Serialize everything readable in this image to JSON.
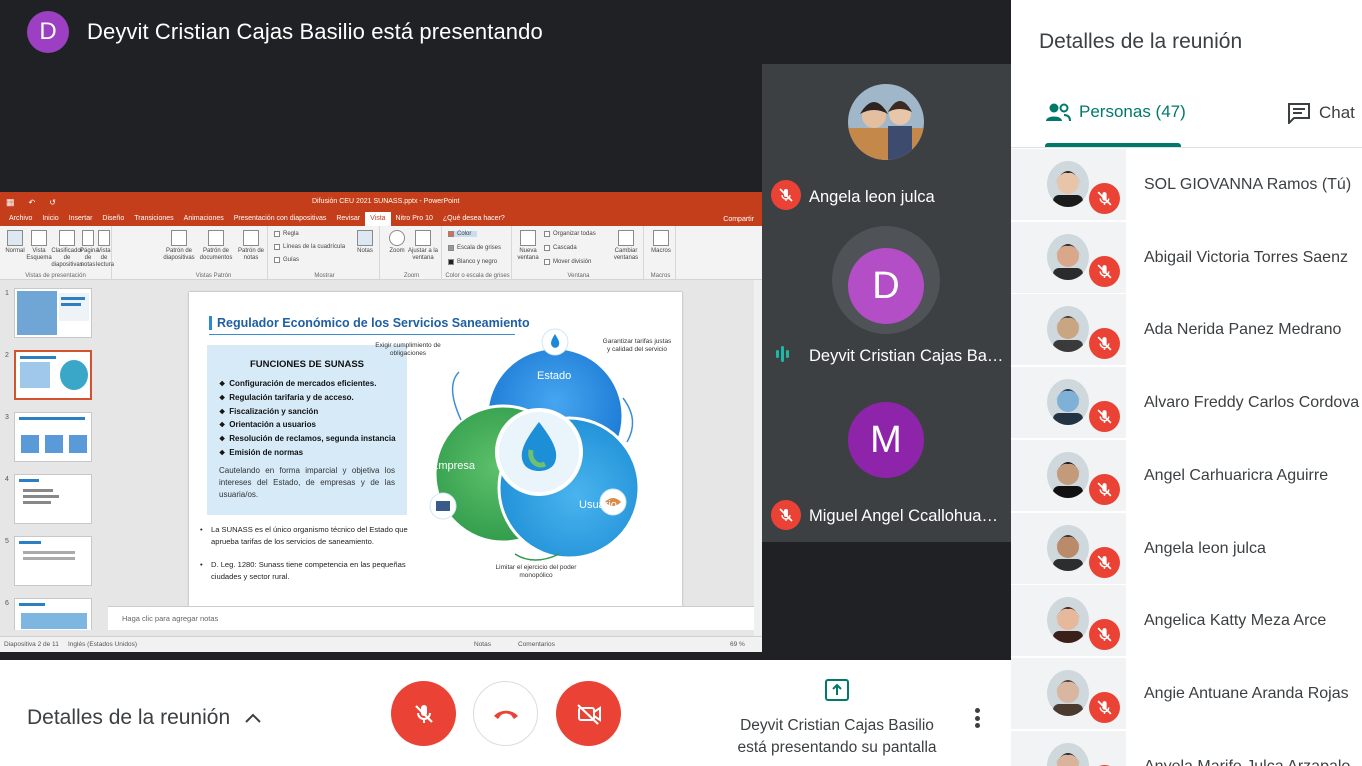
{
  "presenter": {
    "initial": "D",
    "title": "Deyvit Cristian Cajas Basilio está presentando"
  },
  "colors": {
    "accent": "#00796b",
    "mute_red": "#ea4335",
    "avatar_purple": "#9c3fc2",
    "ppt_orange": "#c43e1c"
  },
  "powerpoint": {
    "window_title": "Difusión CEU 2021 SUNASS.pptx - PowerPoint",
    "tabs": [
      "Archivo",
      "Inicio",
      "Insertar",
      "Diseño",
      "Transiciones",
      "Animaciones",
      "Presentación con diapositivas",
      "Revisar",
      "Vista",
      "Nitro Pro 10",
      "¿Qué desea hacer?"
    ],
    "share_label": "Compartir",
    "ribbon": {
      "views": [
        "Normal",
        "Vista Esquema",
        "Clasificador de diapositivas",
        "Página de notas",
        "Vista de lectura"
      ],
      "views_group": "Vistas de presentación",
      "masters": [
        "Patrón de diapositivas",
        "Patrón de documentos",
        "Patrón de notas"
      ],
      "masters_group": "Vistas Patrón",
      "show_checks": [
        "Regla",
        "Líneas de la cuadrícula",
        "Guías"
      ],
      "notes_btn": "Notas",
      "show_group": "Mostrar",
      "zoom_btns": [
        "Zoom",
        "Ajustar a la ventana"
      ],
      "zoom_group": "Zoom",
      "color_opts": [
        "Color",
        "Escala de grises",
        "Blanco y negro"
      ],
      "color_group": "Color o escala de grises",
      "window_btns": [
        "Nueva ventana",
        "Organizar todas",
        "Cascada",
        "Mover división",
        "Cambiar ventanas"
      ],
      "window_group": "Ventana",
      "macros_btn": "Macros",
      "macros_group": "Macros"
    },
    "thumb_numbers": [
      "1",
      "2",
      "3",
      "4",
      "5",
      "6"
    ],
    "slide": {
      "title": "Regulador Económico de los Servicios Saneamiento",
      "functions_title": "FUNCIONES DE SUNASS",
      "functions": [
        "Configuración de mercados eficientes.",
        "Regulación tarifaria y de acceso.",
        "Fiscalización y sanción",
        "Orientación a usuarios",
        "Resolución de reclamos, segunda instancia",
        "Emisión de normas"
      ],
      "paragraph": "Cautelando en forma imparcial y objetiva los intereses del Estado, de empresas y de las usuaria/os.",
      "bullets": [
        "La SUNASS es el único organismo técnico del Estado que aprueba tarifas de los servicios de saneamiento.",
        "D. Leg. 1280: Sunass tiene competencia en las pequeñas ciudades y sector rural."
      ],
      "venn": {
        "estado": "Estado",
        "empresa": "Empresa",
        "usuario": "Usuario",
        "note_left": "Exigir cumplimiento de obligaciones",
        "note_right": "Garantizar tarifas justas y calidad del servicio",
        "note_bottom": "Limitar el ejercicio del poder monopólico"
      }
    },
    "notes_placeholder": "Haga clic para agregar notas",
    "status": {
      "slide": "Diapositiva 2 de 11",
      "lang": "Inglés (Estados Unidos)",
      "notes": "Notas",
      "comments": "Comentarios",
      "zoom": "69 %"
    }
  },
  "tiles": [
    {
      "name": "Angela leon julca",
      "initial": "",
      "muted": true
    },
    {
      "name": "Deyvit Cristian Cajas Basilio",
      "initial": "D",
      "muted": false
    },
    {
      "name": "Miguel Angel Ccallohuanca",
      "initial": "M",
      "muted": true
    }
  ],
  "controls": {
    "details_label": "Detalles de la reunión",
    "presenting_text_1": "Deyvit Cristian Cajas Basilio",
    "presenting_text_2": "está presentando su pantalla"
  },
  "panel": {
    "title": "Detalles de la reunión",
    "people_tab": "Personas (47)",
    "chat_tab": "Chat",
    "people": [
      {
        "name": "SOL GIOVANNA Ramos (Tú)",
        "skin": "#e8c4a8",
        "hair": "#1b1b1b"
      },
      {
        "name": "Abigail Victoria Torres Saenz",
        "skin": "#d9a88a",
        "hair": "#2b2b2b"
      },
      {
        "name": "Ada Nerida Panez Medrano",
        "skin": "#c9a582",
        "hair": "#3a3a3a"
      },
      {
        "name": "Alvaro Freddy Carlos Cordova",
        "skin": "#7fb0d8",
        "hair": "#223344"
      },
      {
        "name": "Angel Carhuaricra Aguirre",
        "skin": "#c49b7a",
        "hair": "#111111"
      },
      {
        "name": "Angela leon julca",
        "skin": "#b98b6a",
        "hair": "#2d2d2d"
      },
      {
        "name": "Angelica Katty Meza Arce",
        "skin": "#e6b89c",
        "hair": "#3b1f1a"
      },
      {
        "name": "Angie Antuane Aranda Rojas",
        "skin": "#d8b6a0",
        "hair": "#4a3a30"
      },
      {
        "name": "Anyela Marife Julca Arzapalo",
        "skin": "#d9b49a",
        "hair": "#2a2a2a"
      }
    ]
  }
}
